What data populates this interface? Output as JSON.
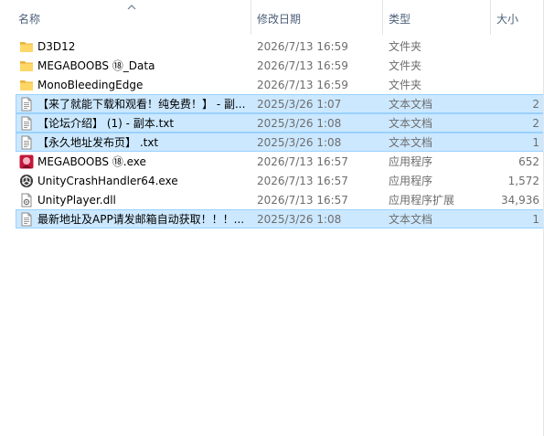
{
  "columns": {
    "name": "名称",
    "date": "修改日期",
    "type": "类型",
    "size": "大小"
  },
  "files": [
    {
      "name": "D3D12",
      "date": "2026/7/13 16:59",
      "type": "文件夹",
      "size": "",
      "icon": "folder-icon",
      "selected": false
    },
    {
      "name": "MEGABOOBS ⑱_Data",
      "date": "2026/7/13 16:59",
      "type": "文件夹",
      "size": "",
      "icon": "folder-icon",
      "selected": false
    },
    {
      "name": "MonoBleedingEdge",
      "date": "2026/7/13 16:59",
      "type": "文件夹",
      "size": "",
      "icon": "folder-icon",
      "selected": false
    },
    {
      "name": "【来了就能下载和观看！纯免费！】 - 副...",
      "date": "2025/3/26 1:07",
      "type": "文本文档",
      "size": "2",
      "icon": "text-file-icon",
      "selected": true
    },
    {
      "name": "【论坛介绍】 (1) - 副本.txt",
      "date": "2025/3/26 1:08",
      "type": "文本文档",
      "size": "2",
      "icon": "text-file-icon",
      "selected": true
    },
    {
      "name": "【永久地址发布页】 .txt",
      "date": "2025/3/26 1:08",
      "type": "文本文档",
      "size": "1",
      "icon": "text-file-icon",
      "selected": true
    },
    {
      "name": "MEGABOOBS ⑱.exe",
      "date": "2026/7/13 16:57",
      "type": "应用程序",
      "size": "652",
      "icon": "app-exe-icon",
      "selected": false
    },
    {
      "name": "UnityCrashHandler64.exe",
      "date": "2026/7/13 16:57",
      "type": "应用程序",
      "size": "1,572",
      "icon": "unity-exe-icon",
      "selected": false
    },
    {
      "name": "UnityPlayer.dll",
      "date": "2026/7/13 16:57",
      "type": "应用程序扩展",
      "size": "34,936",
      "icon": "dll-file-icon",
      "selected": false
    },
    {
      "name": "最新地址及APP请发邮箱自动获取！！！...",
      "date": "2025/3/26 1:08",
      "type": "文本文档",
      "size": "1",
      "icon": "text-file-icon",
      "selected": true
    }
  ]
}
